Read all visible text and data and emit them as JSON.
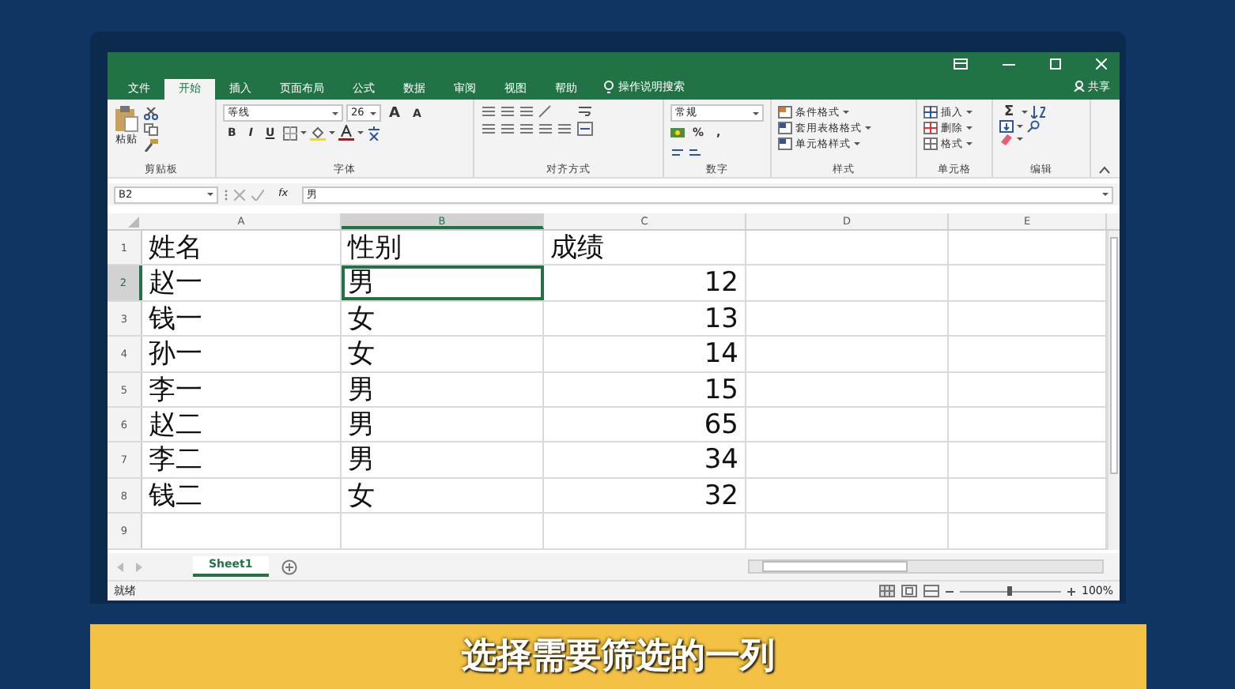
{
  "ribbon_tabs": [
    {
      "label": "文件",
      "selected": false
    },
    {
      "label": "开始",
      "selected": true
    },
    {
      "label": "插入",
      "selected": false
    },
    {
      "label": "页面布局",
      "selected": false
    },
    {
      "label": "公式",
      "selected": false
    },
    {
      "label": "数据",
      "selected": false
    },
    {
      "label": "审阅",
      "selected": false
    },
    {
      "label": "视图",
      "selected": false
    },
    {
      "label": "帮助",
      "selected": false
    }
  ],
  "tell_me": "操作说明搜索",
  "share": "共享",
  "clipboard": {
    "paste": "粘贴",
    "label": "剪贴板"
  },
  "font": {
    "name": "等线",
    "size": "26",
    "grow": "A",
    "shrink": "A",
    "styles": [
      "B",
      "I",
      "U"
    ],
    "label": "字体"
  },
  "alignment": {
    "label": "对齐方式"
  },
  "number": {
    "format": "常规",
    "percent": "%",
    "comma": ",",
    "label": "数字"
  },
  "styles": {
    "items": [
      "条件格式",
      "套用表格格式",
      "单元格样式"
    ],
    "label": "样式"
  },
  "cells": {
    "items": [
      "插入",
      "删除",
      "格式"
    ],
    "label": "单元格"
  },
  "editing": {
    "sum": "Σ",
    "label": "编辑"
  },
  "formula_bar": {
    "name_box": "B2",
    "fx": "fx",
    "value": "男"
  },
  "columns": [
    {
      "letter": "A",
      "selected": false,
      "numeric": false
    },
    {
      "letter": "B",
      "selected": true,
      "numeric": false
    },
    {
      "letter": "C",
      "selected": false,
      "numeric": true
    },
    {
      "letter": "D",
      "selected": false,
      "numeric": false
    },
    {
      "letter": "E",
      "selected": false,
      "numeric": false
    }
  ],
  "rows": [
    {
      "number": "1",
      "selected": false,
      "kind": "header",
      "cells": [
        "姓名",
        "性别",
        "成绩",
        "",
        ""
      ]
    },
    {
      "number": "2",
      "selected": true,
      "kind": "data",
      "cells": [
        "赵一",
        "男",
        "12",
        "",
        ""
      ]
    },
    {
      "number": "3",
      "selected": false,
      "kind": "data",
      "cells": [
        "钱一",
        "女",
        "13",
        "",
        ""
      ]
    },
    {
      "number": "4",
      "selected": false,
      "kind": "data",
      "cells": [
        "孙一",
        "女",
        "14",
        "",
        ""
      ]
    },
    {
      "number": "5",
      "selected": false,
      "kind": "data",
      "cells": [
        "李一",
        "男",
        "15",
        "",
        ""
      ]
    },
    {
      "number": "6",
      "selected": false,
      "kind": "data",
      "cells": [
        "赵二",
        "男",
        "65",
        "",
        ""
      ]
    },
    {
      "number": "7",
      "selected": false,
      "kind": "data",
      "cells": [
        "李二",
        "男",
        "34",
        "",
        ""
      ]
    },
    {
      "number": "8",
      "selected": false,
      "kind": "data",
      "cells": [
        "钱二",
        "女",
        "32",
        "",
        ""
      ]
    },
    {
      "number": "9",
      "selected": false,
      "kind": "data",
      "cells": [
        "",
        "",
        "",
        "",
        ""
      ]
    }
  ],
  "sheet_tabs": [
    {
      "label": "Sheet1",
      "selected": true
    }
  ],
  "status_bar": {
    "text": "就绪",
    "zoom": "100%",
    "level": 0.5
  },
  "subtitle": "选择需要筛选的一列"
}
